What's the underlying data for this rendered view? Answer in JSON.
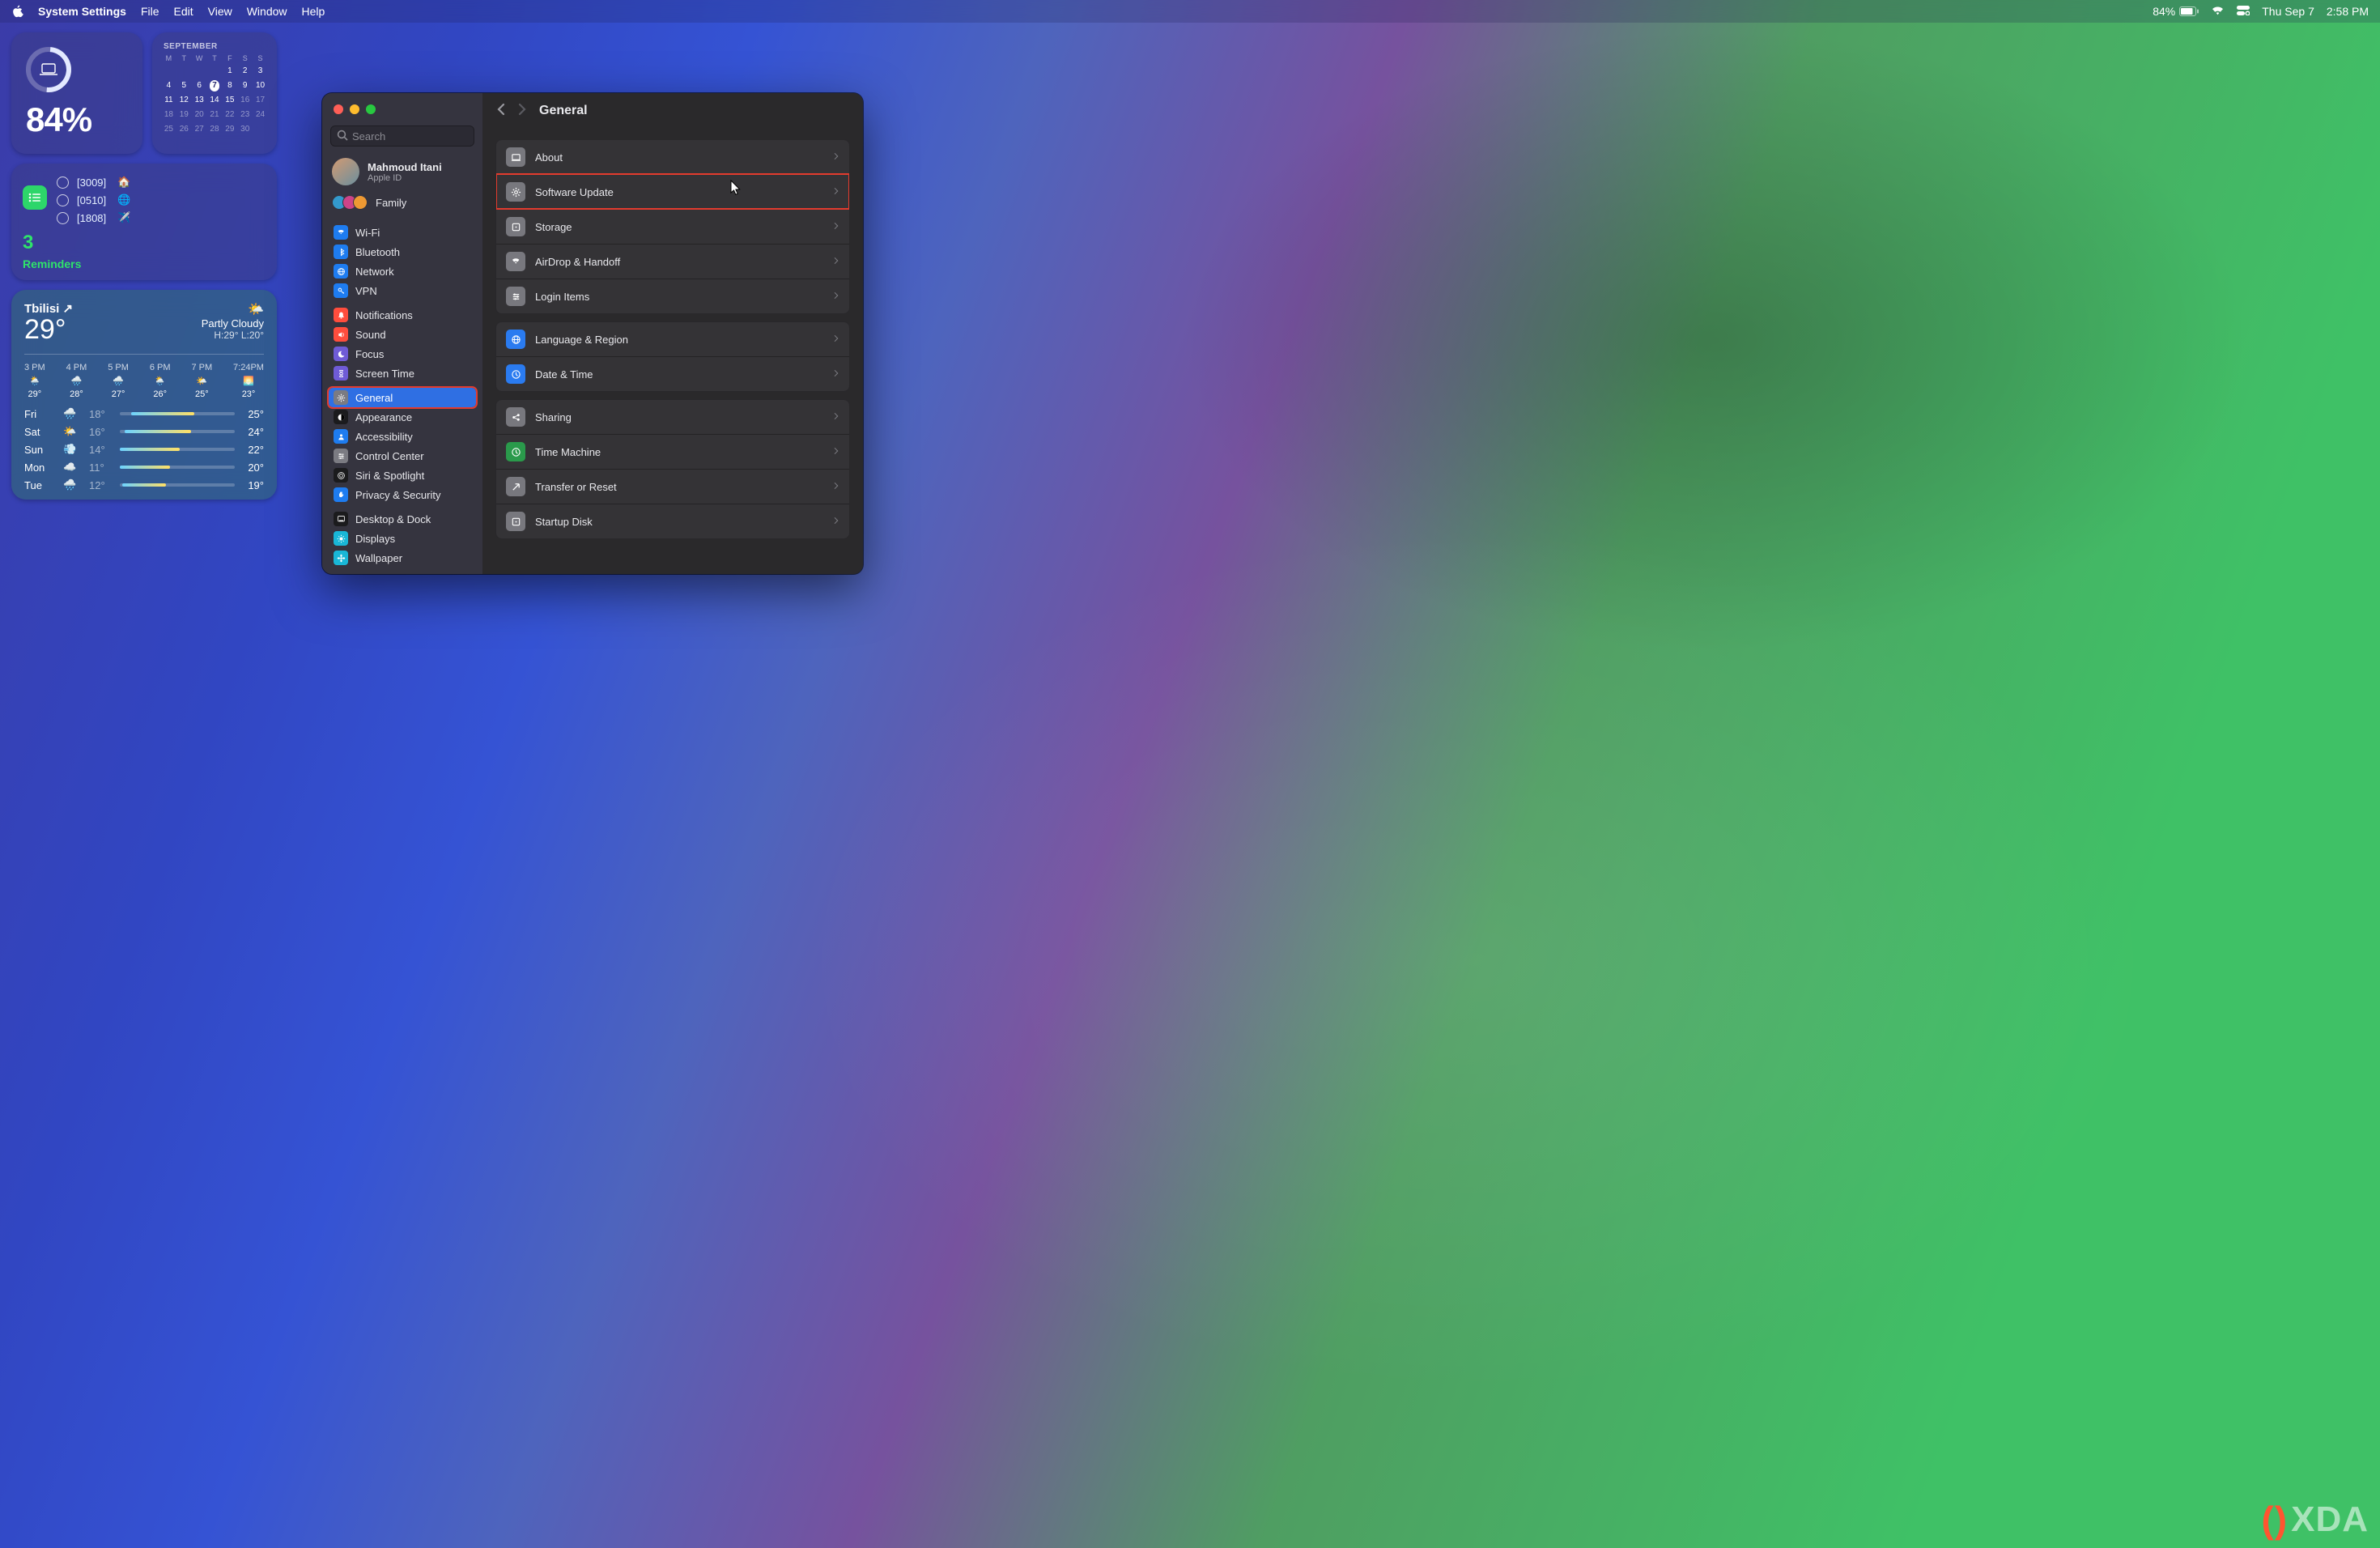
{
  "menubar": {
    "app_name": "System Settings",
    "items": [
      "File",
      "Edit",
      "View",
      "Window",
      "Help"
    ],
    "battery_pct": "84%",
    "date": "Thu Sep 7",
    "time": "2:58 PM"
  },
  "battery_widget": {
    "pct": "84%"
  },
  "calendar": {
    "month": "SEPTEMBER",
    "dow": [
      "M",
      "T",
      "W",
      "T",
      "F",
      "S",
      "S"
    ],
    "weeks": [
      [
        "",
        "",
        "",
        "",
        "1",
        "2",
        "3"
      ],
      [
        "4",
        "5",
        "6",
        "7",
        "8",
        "9",
        "10"
      ],
      [
        "11",
        "12",
        "13",
        "14",
        "15",
        "16",
        "17"
      ],
      [
        "18",
        "19",
        "20",
        "21",
        "22",
        "23",
        "24"
      ],
      [
        "25",
        "26",
        "27",
        "28",
        "29",
        "30",
        ""
      ]
    ],
    "today": "7",
    "dim_from": "16"
  },
  "reminders": {
    "count": "3",
    "title": "Reminders",
    "items": [
      {
        "label": "[3009]",
        "emoji": "🏠"
      },
      {
        "label": "[0510]",
        "emoji": "🌐"
      },
      {
        "label": "[1808]",
        "emoji": "✈️"
      }
    ]
  },
  "weather": {
    "city": "Tbilisi",
    "arrow": "↗",
    "temp": "29°",
    "cond": "Partly Cloudy",
    "hilo": "H:29° L:20°",
    "cond_icon": "🌤️",
    "hours": [
      {
        "h": "3 PM",
        "i": "🌦️",
        "t": "29°"
      },
      {
        "h": "4 PM",
        "i": "🌧️",
        "t": "28°"
      },
      {
        "h": "5 PM",
        "i": "🌧️",
        "t": "27°"
      },
      {
        "h": "6 PM",
        "i": "🌦️",
        "t": "26°"
      },
      {
        "h": "7 PM",
        "i": "🌤️",
        "t": "25°"
      },
      {
        "h": "7:24PM",
        "i": "🌅",
        "t": "23°"
      }
    ],
    "days": [
      {
        "d": "Fri",
        "i": "🌧️",
        "lo": "18°",
        "hi": "25°",
        "l": 10,
        "w": 55
      },
      {
        "d": "Sat",
        "i": "🌤️",
        "lo": "16°",
        "hi": "24°",
        "l": 4,
        "w": 58
      },
      {
        "d": "Sun",
        "i": "💨",
        "lo": "14°",
        "hi": "22°",
        "l": 0,
        "w": 52
      },
      {
        "d": "Mon",
        "i": "☁️",
        "lo": "11°",
        "hi": "20°",
        "l": 0,
        "w": 44
      },
      {
        "d": "Tue",
        "i": "🌧️",
        "lo": "12°",
        "hi": "19°",
        "l": 2,
        "w": 38
      }
    ]
  },
  "settings": {
    "search_placeholder": "Search",
    "user_name": "Mahmoud Itani",
    "user_sub": "Apple ID",
    "family_label": "Family",
    "sidebar": [
      [
        {
          "name": "wifi",
          "label": "Wi-Fi",
          "color": "blue",
          "svg": "wifi"
        },
        {
          "name": "bluetooth",
          "label": "Bluetooth",
          "color": "blue",
          "svg": "bt"
        },
        {
          "name": "network",
          "label": "Network",
          "color": "blue",
          "svg": "globe"
        },
        {
          "name": "vpn",
          "label": "VPN",
          "color": "blue",
          "svg": "key"
        }
      ],
      [
        {
          "name": "notifications",
          "label": "Notifications",
          "color": "red",
          "svg": "bell"
        },
        {
          "name": "sound",
          "label": "Sound",
          "color": "red",
          "svg": "speaker"
        },
        {
          "name": "focus",
          "label": "Focus",
          "color": "purple",
          "svg": "moon"
        },
        {
          "name": "screen-time",
          "label": "Screen Time",
          "color": "purple",
          "svg": "hourglass"
        }
      ],
      [
        {
          "name": "general",
          "label": "General",
          "color": "grey",
          "svg": "gear",
          "selected": true
        },
        {
          "name": "appearance",
          "label": "Appearance",
          "color": "black",
          "svg": "half"
        },
        {
          "name": "accessibility",
          "label": "Accessibility",
          "color": "blue",
          "svg": "person"
        },
        {
          "name": "control-center",
          "label": "Control Center",
          "color": "grey",
          "svg": "sliders"
        },
        {
          "name": "siri",
          "label": "Siri & Spotlight",
          "color": "black",
          "svg": "siri"
        },
        {
          "name": "privacy",
          "label": "Privacy & Security",
          "color": "blue",
          "svg": "hand"
        }
      ],
      [
        {
          "name": "desktop-dock",
          "label": "Desktop & Dock",
          "color": "black",
          "svg": "dock"
        },
        {
          "name": "displays",
          "label": "Displays",
          "color": "cyan",
          "svg": "sun"
        },
        {
          "name": "wallpaper",
          "label": "Wallpaper",
          "color": "cyan",
          "svg": "flower"
        }
      ]
    ],
    "title": "General",
    "groups": [
      [
        {
          "name": "about",
          "label": "About",
          "ic": "grey"
        },
        {
          "name": "software-update",
          "label": "Software Update",
          "ic": "grey",
          "highlight": true
        },
        {
          "name": "storage",
          "label": "Storage",
          "ic": "grey"
        },
        {
          "name": "airdrop",
          "label": "AirDrop & Handoff",
          "ic": "white"
        },
        {
          "name": "login-items",
          "label": "Login Items",
          "ic": "grey"
        }
      ],
      [
        {
          "name": "language-region",
          "label": "Language & Region",
          "ic": "blue"
        },
        {
          "name": "date-time",
          "label": "Date & Time",
          "ic": "blue"
        }
      ],
      [
        {
          "name": "sharing",
          "label": "Sharing",
          "ic": "grey"
        },
        {
          "name": "time-machine",
          "label": "Time Machine",
          "ic": "green"
        },
        {
          "name": "transfer-reset",
          "label": "Transfer or Reset",
          "ic": "grey"
        },
        {
          "name": "startup-disk",
          "label": "Startup Disk",
          "ic": "grey"
        }
      ]
    ]
  },
  "watermark": "XDA"
}
